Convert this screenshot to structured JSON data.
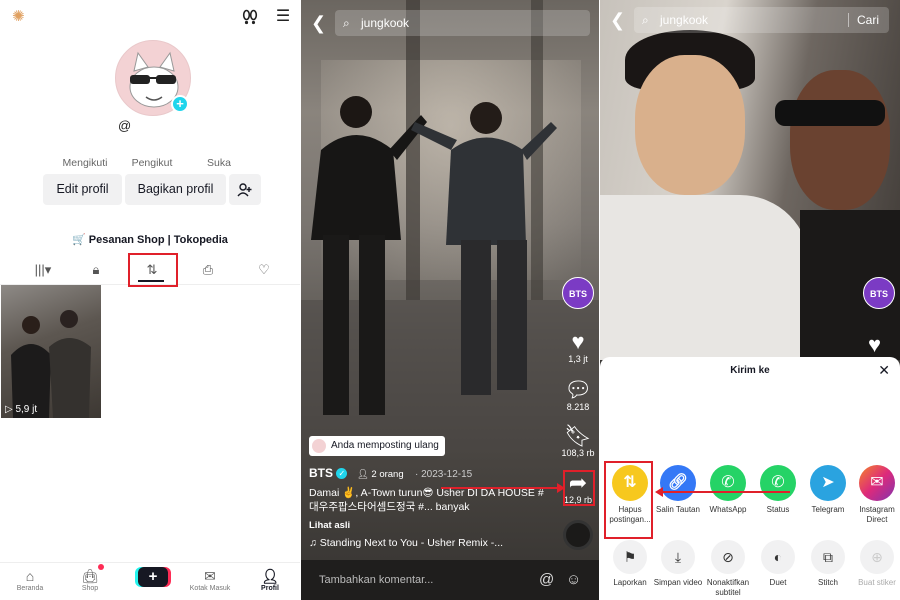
{
  "panel1": {
    "handle": "@",
    "stats": [
      "Mengikuti",
      "Pengikut",
      "Suka"
    ],
    "edit_profile": "Edit profil",
    "share_profile": "Bagikan profil",
    "shop_link": "Pesanan Shop | Tokopedia",
    "thumb_views": "5,9 jt",
    "nav": [
      "Beranda",
      "Shop",
      "+",
      "Kotak Masuk",
      "Profil"
    ]
  },
  "panel2": {
    "search_query": "jungkook",
    "likes": "1,3 jt",
    "comments": "8.218",
    "saves": "108,3 rb",
    "shares": "12,9 rb",
    "bts_label": "BTS",
    "repost_notice": "Anda memposting ulang",
    "author": "BTS",
    "people_tag": "2 orang",
    "date": "2023-12-15",
    "caption": "Damai ✌️, A-Town turun😎 Usher DI DA HOUSE #대우주팝스타어셈드정국 #... banyak",
    "lihat_asli": "Lihat asli",
    "music": "♫ Standing Next to You - Usher Remix -...",
    "comment_placeholder": "Tambahkan komentar..."
  },
  "panel3": {
    "search_query": "jungkook",
    "search_button": "Cari",
    "bts_label": "BTS",
    "sheet_title": "Kirim ke",
    "share_targets": [
      {
        "label": "Hapus postingan...",
        "color": "#f7c81e"
      },
      {
        "label": "Salin Tautan",
        "color": "#3478f6"
      },
      {
        "label": "WhatsApp",
        "color": "#25d366"
      },
      {
        "label": "Status",
        "color": "#25d366"
      },
      {
        "label": "Telegram",
        "color": "#2aa3e0"
      },
      {
        "label": "Instagram Direct",
        "color": "#c13584"
      }
    ],
    "actions": [
      "Laporkan",
      "Simpan video",
      "Nonaktifkan subtitel",
      "Duet",
      "Stitch",
      "Buat stiker"
    ]
  },
  "colors": {
    "highlight_red": "#e0202a",
    "tiktok_pink": "#fe2c55",
    "tiktok_cyan": "#25f4ee"
  }
}
